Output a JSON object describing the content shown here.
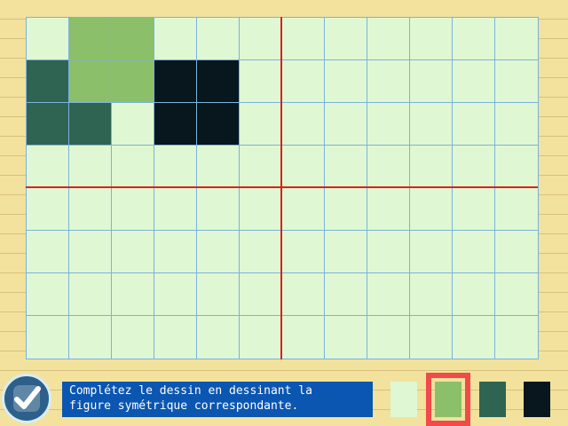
{
  "instruction": "Complétez le dessin en dessinant la\nfigure symétrique correspondante.",
  "colors": {
    "empty": "#dff7d2",
    "light_green": "#8bbf6a",
    "dark_green": "#2f6452",
    "black": "#08161e",
    "axis": "#e41d1d",
    "gridline": "#7cb3da",
    "selection_border": "#f04a4a",
    "instruction_bg": "#0b56b0"
  },
  "grid": {
    "rows": 8,
    "cols": 12,
    "cells": [
      [
        0,
        1,
        1,
        0,
        0,
        0,
        0,
        0,
        0,
        0,
        0,
        0
      ],
      [
        2,
        1,
        1,
        3,
        3,
        0,
        0,
        0,
        0,
        0,
        0,
        0
      ],
      [
        2,
        2,
        0,
        3,
        3,
        0,
        0,
        0,
        0,
        0,
        0,
        0
      ],
      [
        0,
        0,
        0,
        0,
        0,
        0,
        0,
        0,
        0,
        0,
        0,
        0
      ],
      [
        0,
        0,
        0,
        0,
        0,
        0,
        0,
        0,
        0,
        0,
        0,
        0
      ],
      [
        0,
        0,
        0,
        0,
        0,
        0,
        0,
        0,
        0,
        0,
        0,
        0
      ],
      [
        0,
        0,
        0,
        0,
        0,
        0,
        0,
        0,
        0,
        0,
        0,
        0
      ],
      [
        0,
        0,
        0,
        0,
        0,
        0,
        0,
        0,
        0,
        0,
        0,
        0
      ]
    ]
  },
  "palette": {
    "swatches": [
      "#dff7d2",
      "#8bbf6a",
      "#2f6452",
      "#08161e"
    ],
    "selected_index": 1
  },
  "ok_button": {
    "icon": "checkmark-icon"
  }
}
